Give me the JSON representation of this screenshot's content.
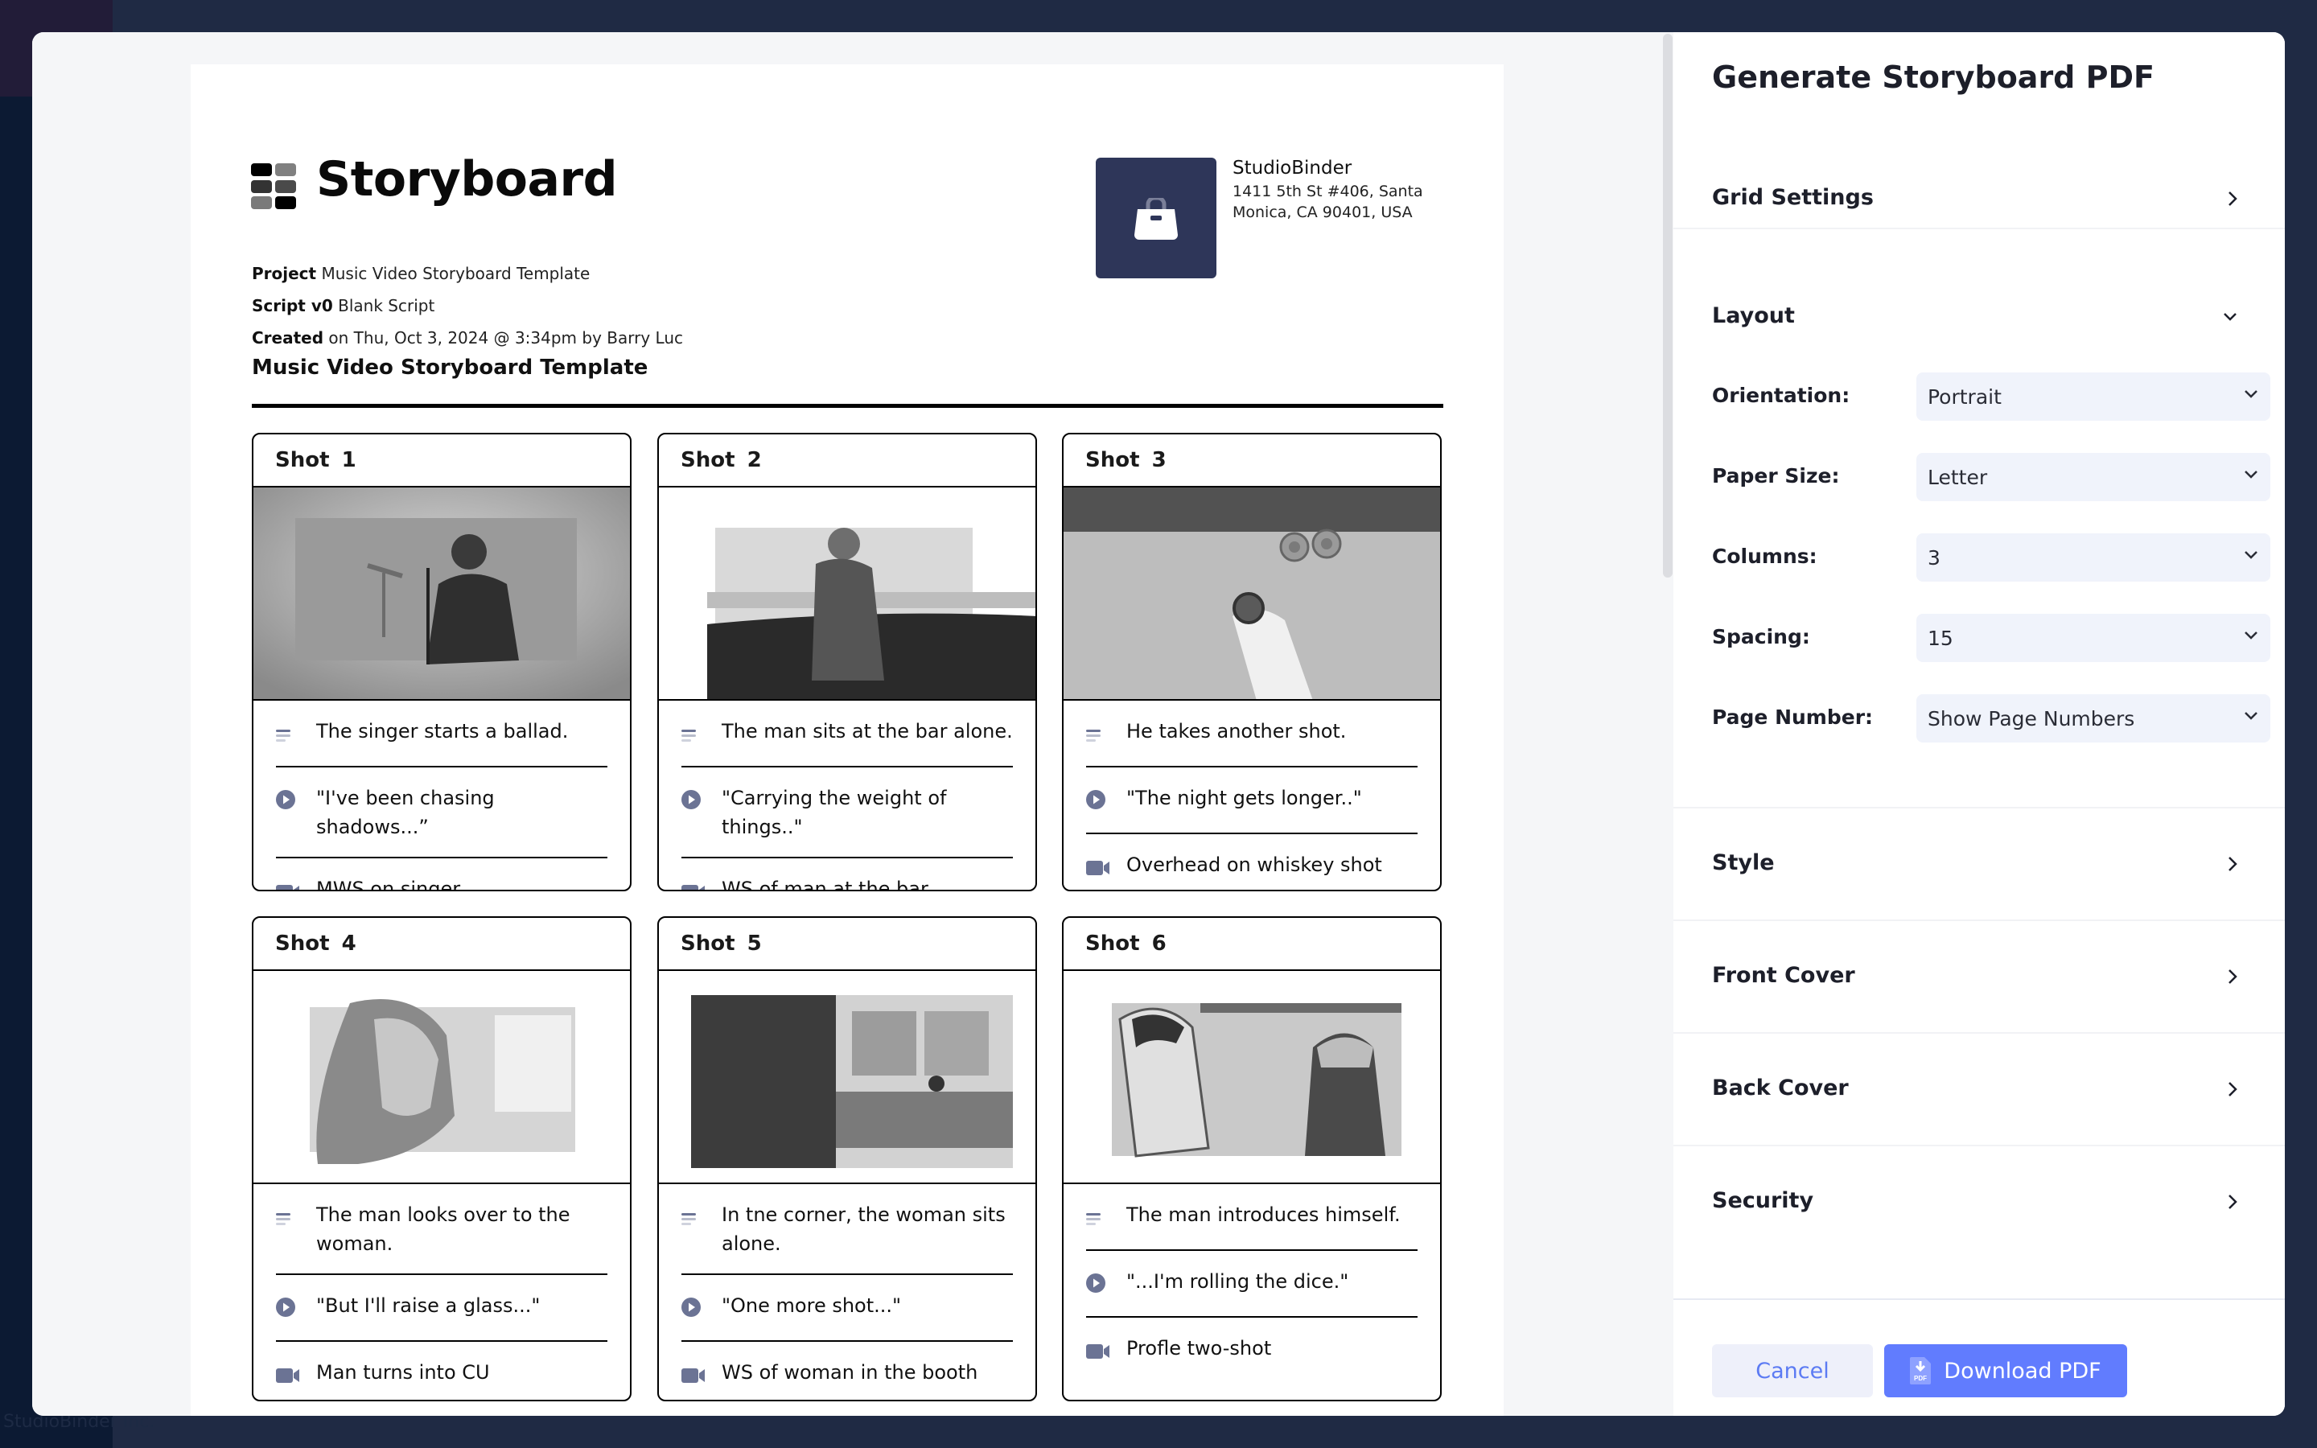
{
  "document": {
    "title": "Storyboard",
    "meta": [
      {
        "label": "Project",
        "value": "Music Video Storyboard Template"
      },
      {
        "label": "Script v0",
        "value": "Blank Script"
      },
      {
        "label": "Created",
        "value": "on Thu, Oct 3, 2024 @ 3:34pm by Barry Luc"
      }
    ],
    "company": {
      "name": "StudioBinder",
      "address": "1411 5th St #406, Santa Monica, CA 90401, USA",
      "logo_icon": "briefcase-icon"
    },
    "section_title": "Music Video Storyboard Template",
    "shots": [
      {
        "label": "Shot",
        "number": "1",
        "description": "The singer starts a ballad.",
        "dialogue": "\"I've been chasing shadows...”",
        "camera": "MWS on singer"
      },
      {
        "label": "Shot",
        "number": "2",
        "description": "The man sits at the bar alone.",
        "dialogue": "\"Carrying the weight of things..\"",
        "camera": "WS of man at the bar"
      },
      {
        "label": "Shot",
        "number": "3",
        "description": "He takes another shot.",
        "dialogue": "\"The night gets longer..\"",
        "camera": "Overhead on whiskey shot"
      },
      {
        "label": "Shot",
        "number": "4",
        "description": "The man looks over to the woman.",
        "dialogue": "\"But I'll raise a glass...\"",
        "camera": "Man turns into CU"
      },
      {
        "label": "Shot",
        "number": "5",
        "description": "In tne corner, the woman sits alone.",
        "dialogue": "\"One more shot...\"",
        "camera": "WS of woman in the booth"
      },
      {
        "label": "Shot",
        "number": "6",
        "description": "The man introduces himself.",
        "dialogue": "\"...I'm rolling the dice.\"",
        "camera": "Profle two-shot"
      }
    ],
    "row_icons": [
      "description-lines-icon",
      "play-circle-icon",
      "video-camera-icon"
    ]
  },
  "panel": {
    "title": "Generate Storyboard PDF",
    "sections": {
      "grid_settings": "Grid Settings",
      "layout": "Layout",
      "style": "Style",
      "front_cover": "Front Cover",
      "back_cover": "Back Cover",
      "security": "Security"
    },
    "layout_fields": [
      {
        "label": "Orientation:",
        "value": "Portrait"
      },
      {
        "label": "Paper Size:",
        "value": "Letter"
      },
      {
        "label": "Columns:",
        "value": "3"
      },
      {
        "label": "Spacing:",
        "value": "15"
      },
      {
        "label": "Page Number:",
        "value": "Show Page Numbers"
      }
    ],
    "buttons": {
      "cancel": "Cancel",
      "download": "Download PDF",
      "download_icon_text": "PDF"
    }
  },
  "backdrop": {
    "footer_text": "StudioBinder Inc."
  },
  "colors": {
    "accent": "#617cfe",
    "company_logo_bg": "#2e3659",
    "icon": "#6b7394",
    "select_bg": "#f0f3fb"
  }
}
